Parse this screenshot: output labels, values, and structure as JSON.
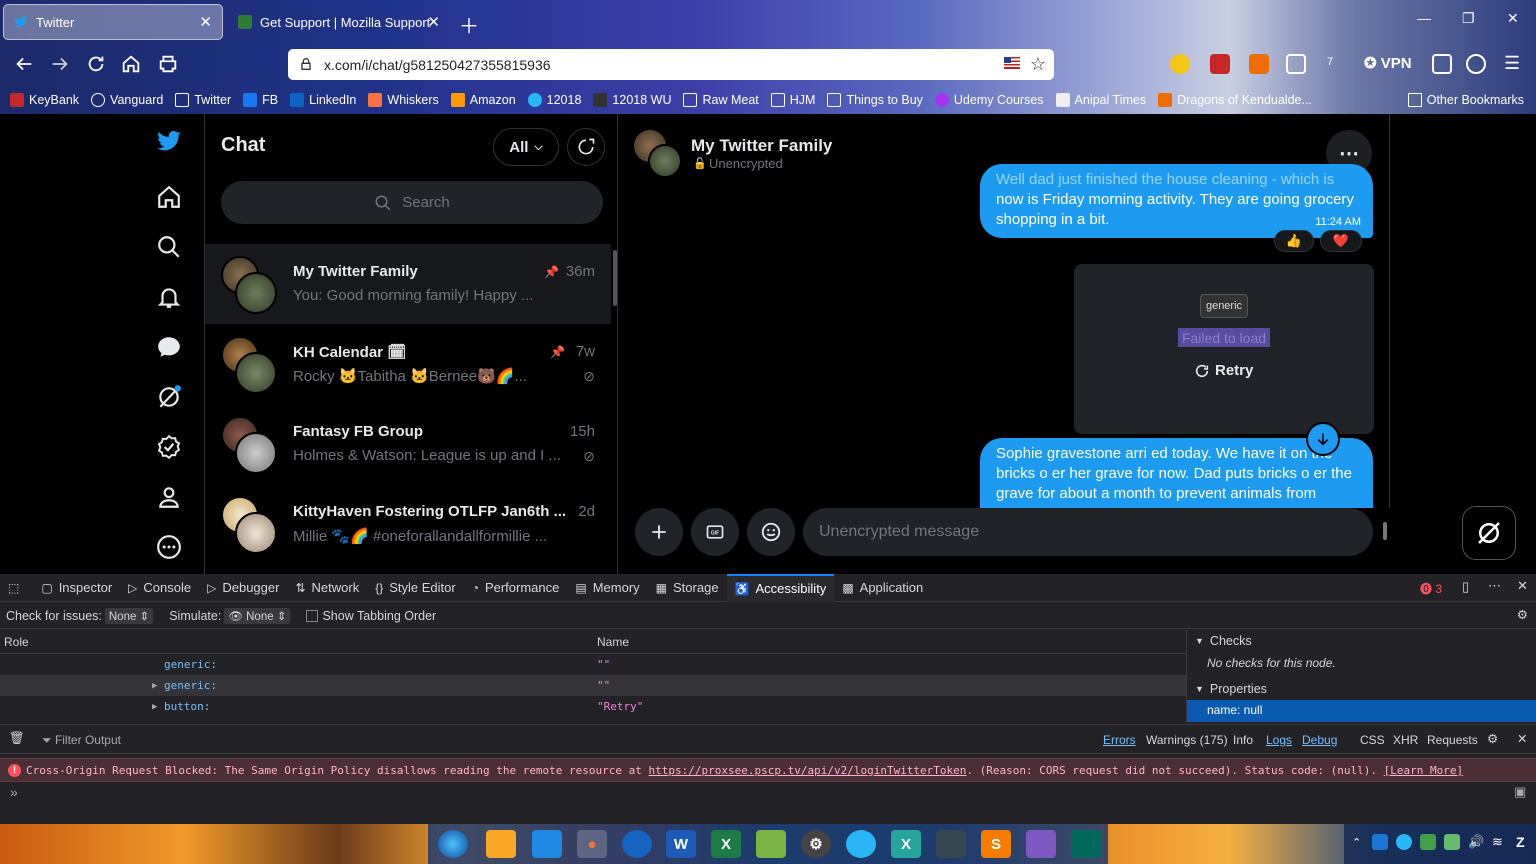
{
  "browser": {
    "tabs": [
      {
        "title": "Twitter",
        "active": true
      },
      {
        "title": "Get Support | Mozilla Support",
        "active": false
      }
    ],
    "url": "x.com/i/chat/g581250427355815936",
    "vpn_label": "VPN",
    "ext_badge": "7",
    "bookmarks": [
      "KeyBank",
      "Vanguard",
      "Twitter",
      "FB",
      "LinkedIn",
      "Whiskers",
      "Amazon",
      "12018",
      "12018 WU",
      "Raw Meat",
      "HJM",
      "Things to Buy",
      "Udemy Courses",
      "Anipal Times",
      "Dragons of Kendualde..."
    ],
    "other_bookmarks": "Other Bookmarks"
  },
  "chat": {
    "title": "Chat",
    "filter_label": "All",
    "search_placeholder": "Search",
    "conversations": [
      {
        "name": "My Twitter Family",
        "preview": "You: Good morning family! Happy ...",
        "time": "36m",
        "pinned": true
      },
      {
        "name": "KH Calendar 🗓",
        "preview": "Rocky 🐱Tabitha 🐱Bernee🐻🌈...",
        "time": "7w",
        "pinned": true
      },
      {
        "name": "Fantasy FB Group",
        "preview": "Holmes & Watson: League is up and I ...",
        "time": "15h",
        "pinned": false
      },
      {
        "name": "KittyHaven Fostering OTLFP Jan6th ...",
        "preview": "Millie 🐾🌈 #oneforallandallformillie ...",
        "time": "2d",
        "pinned": false
      }
    ]
  },
  "conversation": {
    "name": "My Twitter Family",
    "encryption": "Unencrypted",
    "msg1_faded": "Well dad just finished the house cleaning - which is",
    "msg1_rest": "now is Friday morning activity.  They are going grocery shopping in a bit.",
    "msg1_time": "11:24 AM",
    "reactions": [
      "👍",
      "❤️"
    ],
    "tooltip": "generic",
    "failed_text": "Failed to load",
    "retry_label": "Retry",
    "msg2": "Sophie gravestone arri ed today.  We have it on the bricks o er her grave for now.  Dad puts bricks o er the grave for about a month to prevent animals from",
    "input_placeholder": "Unencrypted message"
  },
  "devtools": {
    "tabs": [
      "Inspector",
      "Console",
      "Debugger",
      "Network",
      "Style Editor",
      "Performance",
      "Memory",
      "Storage",
      "Accessibility",
      "Application"
    ],
    "active_tab": "Accessibility",
    "error_count": "3",
    "check_label": "Check for issues:",
    "check_value": "None",
    "simulate_label": "Simulate:",
    "simulate_value": "None",
    "tabbing_label": "Show Tabbing Order",
    "col_role": "Role",
    "col_name": "Name",
    "rows": [
      {
        "role": "generic:",
        "name": "\"\""
      },
      {
        "role": "generic:",
        "name": "\"\""
      },
      {
        "role": "button:",
        "name": "\"Retry\""
      }
    ],
    "checks_title": "Checks",
    "checks_text": "No checks for this node.",
    "properties_title": "Properties",
    "property": "name: null",
    "filter_output": "Filter Output",
    "console_filters": [
      "Errors",
      "Warnings (175)",
      "Info",
      "Logs",
      "Debug",
      "CSS",
      "XHR",
      "Requests"
    ],
    "error_msg": "Cross-Origin Request Blocked: The Same Origin Policy disallows reading the remote resource at",
    "error_url": "https://proxsee.pscp.tv/api/v2/loginTwitterToken",
    "error_reason": ". (Reason: CORS request did not succeed). Status code: (null).",
    "learn_more": "[Learn More]",
    "prompt": "»"
  }
}
